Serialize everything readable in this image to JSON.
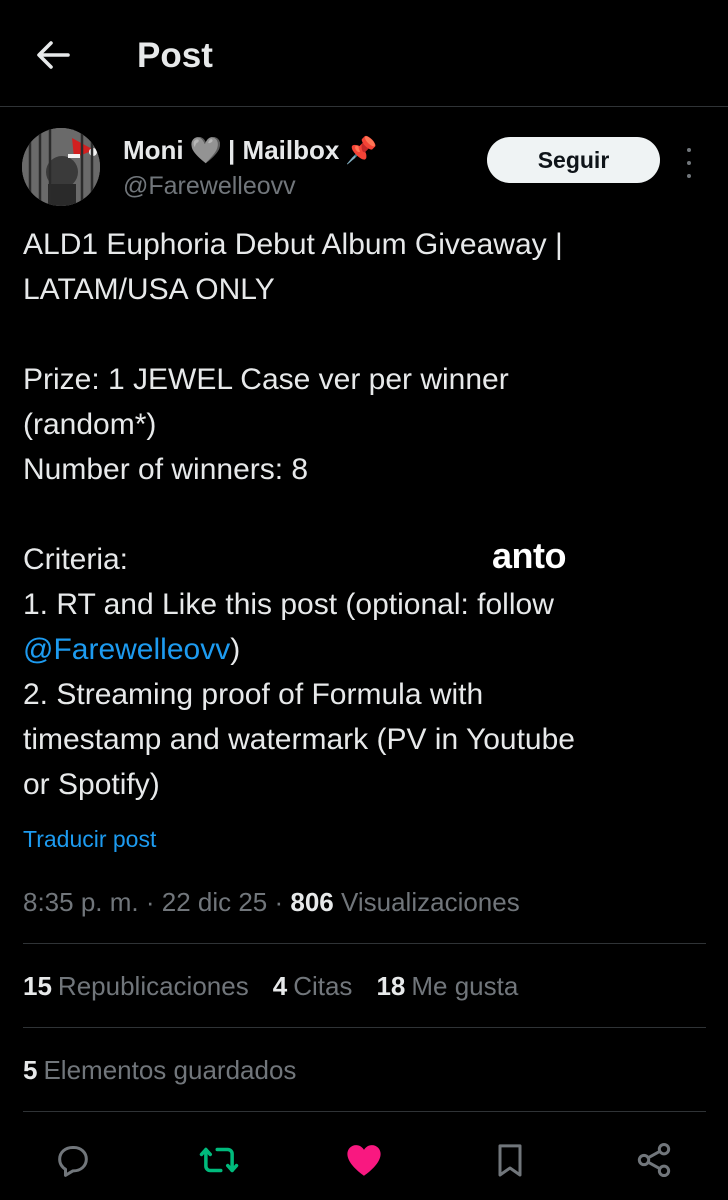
{
  "header": {
    "title": "Post"
  },
  "author": {
    "name": "Moni",
    "name_suffix": "| Mailbox",
    "handle": "@Farewelleovv",
    "heart_emoji": "🩶",
    "pin_emoji": "📌"
  },
  "follow_button": {
    "label": "Seguir"
  },
  "post": {
    "lines": [
      "ALD1 Euphoria Debut Album Giveaway |",
      "LATAM/USA ONLY",
      "",
      "Prize: 1 JEWEL Case ver per winner",
      "(random*)",
      "Number of winners: 8",
      "",
      "Criteria:",
      "1. RT and Like this post (optional: follow"
    ],
    "mention": "@Farewelleovv",
    "mention_after": ")",
    "lines_after": [
      "2. Streaming proof of Formula with",
      "timestamp and watermark (PV in Youtube",
      "or Spotify)"
    ]
  },
  "watermark": "anto",
  "translate_label": "Traducir post",
  "meta": {
    "time": "8:35 p. m.",
    "sep1": " · ",
    "date": "22 dic 25",
    "sep2": " · ",
    "views_count": "806",
    "views_label": " Visualizaciones"
  },
  "stats": {
    "reposts_count": "15",
    "reposts_label": "Republicaciones",
    "quotes_count": "4",
    "quotes_label": "Citas",
    "likes_count": "18",
    "likes_label": "Me gusta",
    "saved_count": "5",
    "saved_label": "Elementos guardados"
  },
  "actions": [
    {
      "icon": "reply-icon"
    },
    {
      "icon": "repost-icon",
      "color": "#00ba7c"
    },
    {
      "icon": "like-icon",
      "color": "#f91880"
    },
    {
      "icon": "bookmark-icon"
    },
    {
      "icon": "share-icon"
    }
  ],
  "colors": {
    "background": "#000000",
    "text": "#e7e9ea",
    "muted": "#71767b",
    "link": "#1d9bf0",
    "repost_active": "#00ba7c",
    "like_active": "#f91880"
  }
}
